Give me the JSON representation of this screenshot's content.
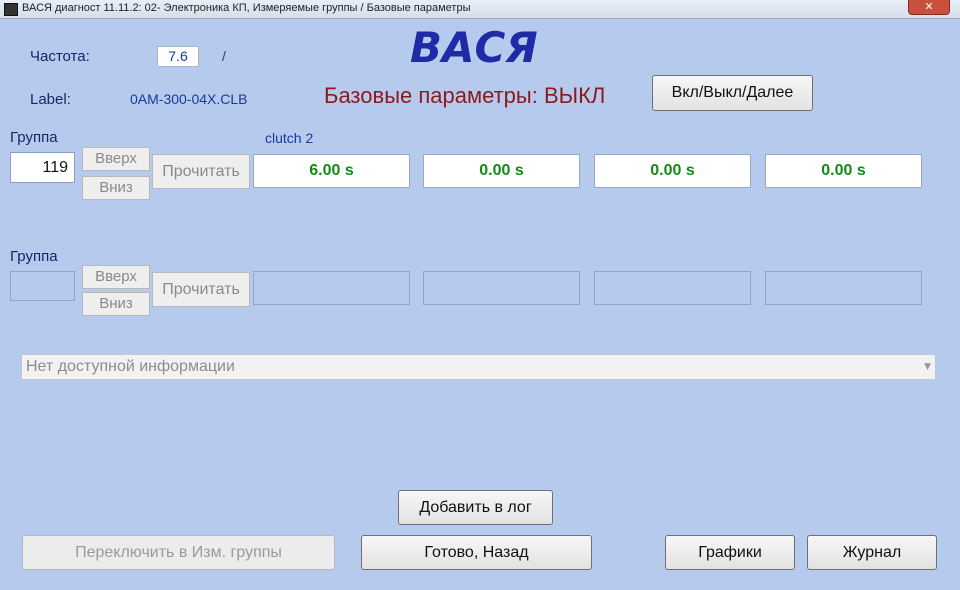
{
  "window": {
    "title": "ВАСЯ диагност 11.11.2: 02- Электроника КП,  Измеряемые группы / Базовые параметры",
    "close_glyph": "✕"
  },
  "header": {
    "freq_label": "Частота:",
    "freq_value": "7.6",
    "freq_sep": "/",
    "label_label": "Label:",
    "label_value": "0AM-300-04X.CLB",
    "logo": "ВАСЯ",
    "status_text": "Базовые параметры: ВЫКЛ",
    "toggle_button": "Вкл/Выкл/Далее"
  },
  "group1": {
    "label": "Группа",
    "number": "119",
    "up": "Вверх",
    "down": "Вниз",
    "read": "Прочитать",
    "field_title": "clutch 2",
    "values": [
      "6.00 s",
      "0.00 s",
      "0.00 s",
      "0.00 s"
    ]
  },
  "group2": {
    "label": "Группа",
    "number": "",
    "up": "Вверх",
    "down": "Вниз",
    "read": "Прочитать"
  },
  "info_combo": {
    "text": "Нет доступной информации",
    "arrow": "▼"
  },
  "footer": {
    "add_log": "Добавить в лог",
    "switch": "Переключить в Изм. группы",
    "done_back": "Готово, Назад",
    "graphs": "Графики",
    "journal": "Журнал"
  },
  "colors": {
    "background": "#b6caee",
    "value_green": "#158a15",
    "status_red": "#8b1a1a",
    "logo_blue": "#1f2aa6"
  }
}
